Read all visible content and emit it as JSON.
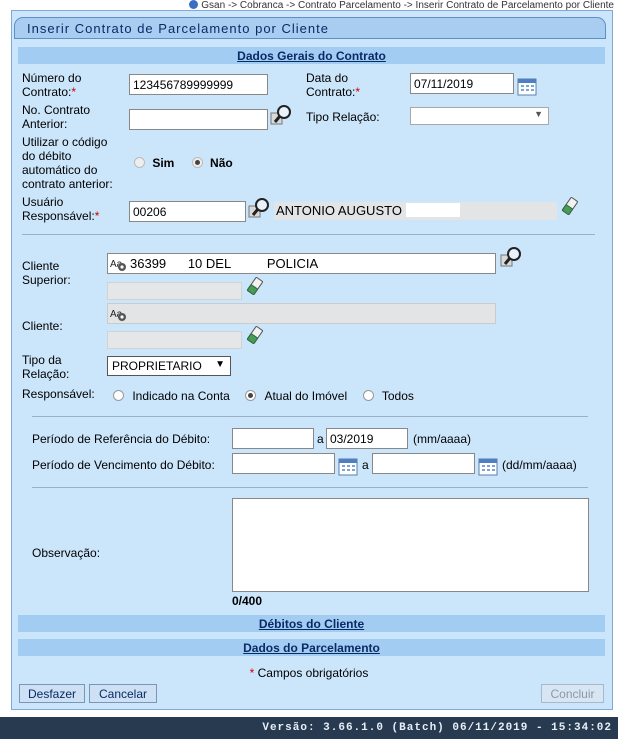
{
  "breadcrumb": "Gsan -> Cobranca -> Contrato Parcelamento -> Inserir Contrato de Parcelamento por Cliente",
  "page_title": "Inserir Contrato de Parcelamento por Cliente",
  "sections": {
    "dados_gerais": "Dados Gerais do Contrato",
    "debitos_cliente": "Débitos do Cliente",
    "dados_parcelamento": "Dados do Parcelamento"
  },
  "form": {
    "numero_contrato_label_1": "Número do",
    "numero_contrato_label_2": "Contrato:",
    "numero_contrato_value": "123456789999999",
    "data_contrato_label_1": "Data do",
    "data_contrato_label_2": "Contrato:",
    "data_contrato_value": "07/11/2019",
    "no_contrato_anterior_label_1": "No. Contrato",
    "no_contrato_anterior_label_2": "Anterior:",
    "no_contrato_anterior_value": "",
    "tipo_relacao_label": "Tipo Relação:",
    "tipo_relacao_value": "",
    "utilizar_codigo_label_1": "Utilizar o código",
    "utilizar_codigo_label_2": "do débito",
    "utilizar_codigo_label_3": "automático do",
    "utilizar_codigo_label_4": "contrato anterior:",
    "sim_label": "Sim",
    "nao_label": "Não",
    "usuario_label_1": "Usuário",
    "usuario_label_2": "Responsável:",
    "usuario_code": "00206",
    "usuario_name": "ANTONIO AUGUSTO",
    "cliente_superior_label_1": "Cliente",
    "cliente_superior_label_2": "Superior:",
    "cliente_superior_value": "36399      10 DEL          POLICIA",
    "cliente_superior_extra": "",
    "cliente_label": "Cliente:",
    "cliente_value": "",
    "cliente_extra": "",
    "tipo_da_relacao_label_1": "Tipo da",
    "tipo_da_relacao_label_2": "Relação:",
    "tipo_da_relacao_value": "PROPRIETARIO",
    "responsavel_label": "Responsável:",
    "resp_option_1": "Indicado na Conta",
    "resp_option_2": "Atual do Imóvel",
    "resp_option_3": "Todos",
    "periodo_ref_label": "Período de Referência do Débito:",
    "periodo_ref_de": "",
    "periodo_ref_a_label": "a",
    "periodo_ref_ate": "03/2019",
    "periodo_ref_format": "(mm/aaaa)",
    "periodo_venc_label": "Período de Vencimento do Débito:",
    "periodo_venc_de": "",
    "periodo_venc_a_label": "a",
    "periodo_venc_ate": "",
    "periodo_venc_format": "(dd/mm/aaaa)",
    "observacao_label": "Observação:",
    "observacao_value": "",
    "observacao_counter": "0/400"
  },
  "required_note": "Campos obrigatórios",
  "required_mark": "*",
  "buttons": {
    "desfazer": "Desfazer",
    "cancelar": "Cancelar",
    "concluir": "Concluir"
  },
  "version": "Versão: 3.66.1.0 (Batch) 06/11/2019 - 15:34:02",
  "icons": {
    "search": "magnifier-icon",
    "calendar": "calendar-icon",
    "eraser": "eraser-icon",
    "client_type": "client-icon"
  },
  "colors": {
    "panel_bg": "#cbe5fb",
    "section_bg": "#a3ccf2",
    "title_text": "#0a2a66",
    "required": "#cc0000",
    "footer_bg": "#283a50"
  }
}
